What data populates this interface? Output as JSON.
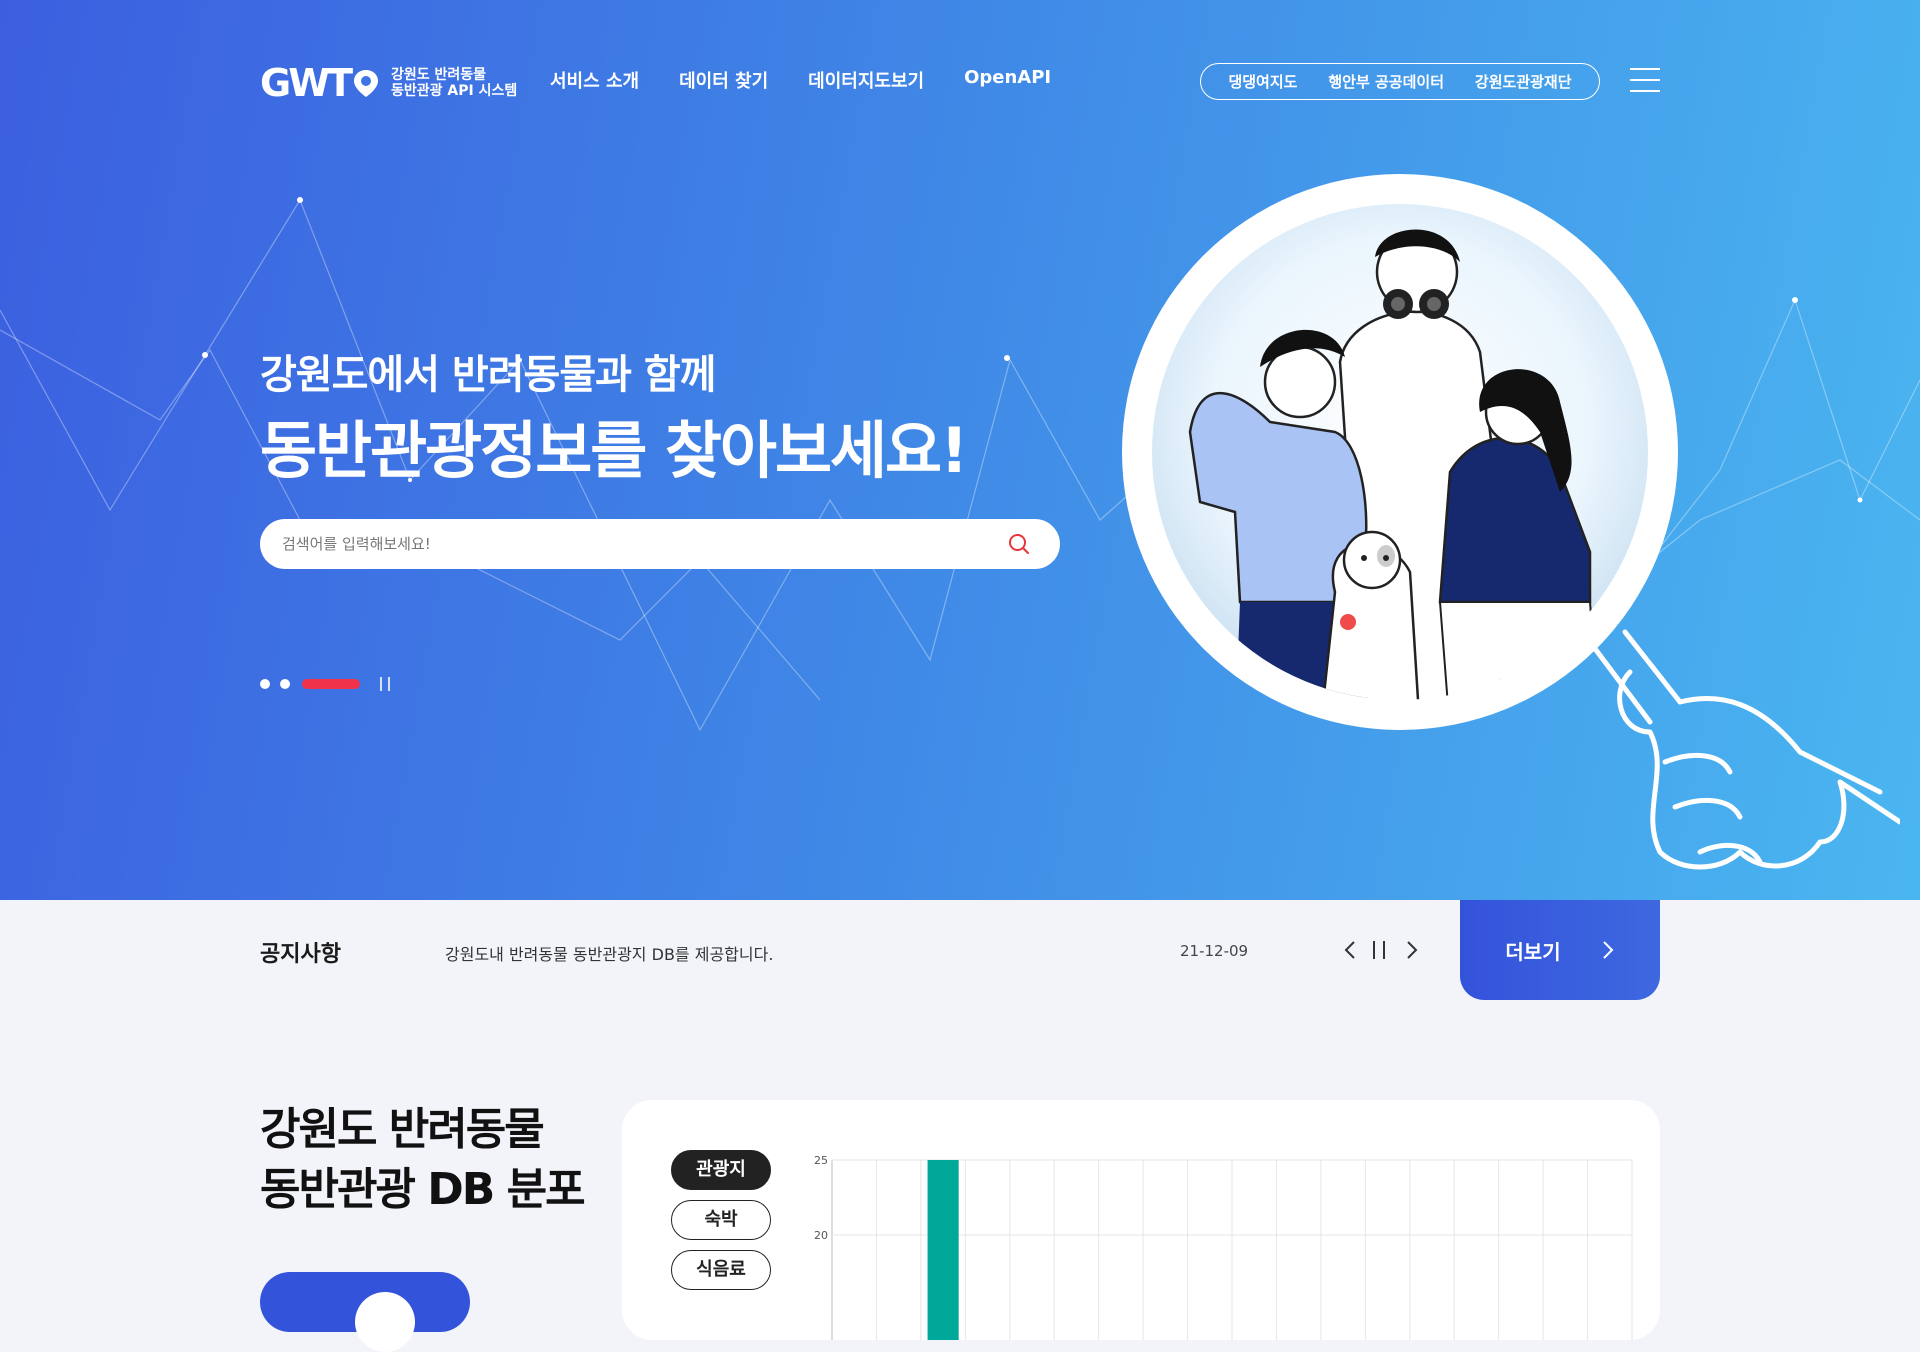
{
  "header": {
    "logo_mark": "GWT",
    "logo_line1": "강원도 반려동물",
    "logo_line2": "동반관광 API 시스템",
    "nav": [
      "서비스 소개",
      "데이터 찾기",
      "데이터지도보기",
      "OpenAPI"
    ],
    "quick_links": [
      "댕댕여지도",
      "행안부 공공데이터",
      "강원도관광재단"
    ],
    "menu_icon": "hamburger-icon"
  },
  "hero": {
    "subtitle": "강원도에서 반려동물과 함께",
    "title": "동반관광정보를 찾아보세요!",
    "search_placeholder": "검색어를 입력해보세요!",
    "search_icon": "search-icon",
    "slides_total": 3,
    "slide_active": 3,
    "colors": {
      "gradient_start": "#3c5fe0",
      "gradient_end": "#4ab6f0",
      "accent": "#f0334a"
    }
  },
  "notice": {
    "label": "공지사항",
    "text": "강원도내 반려동물 동반관광지 DB를 제공합니다.",
    "date": "21-12-09",
    "more_label": "더보기"
  },
  "db_section": {
    "title_line1": "강원도 반려동물",
    "title_line2": "동반관광 DB 분포",
    "categories": [
      "관광지",
      "숙박",
      "식음료"
    ],
    "active_category": "관광지"
  },
  "chart_data": {
    "type": "bar",
    "categories": [
      "",
      "",
      "",
      "",
      "",
      "",
      "",
      "",
      "",
      "",
      "",
      "",
      "",
      "",
      "",
      "",
      "",
      ""
    ],
    "values": [
      0,
      0,
      25,
      0,
      0,
      0,
      0,
      0,
      0,
      0,
      0,
      0,
      0,
      0,
      0,
      0,
      0,
      0
    ],
    "y_ticks": [
      "25",
      "20"
    ],
    "ylim_visible": [
      15,
      25
    ],
    "grid": true,
    "bar_color": "#00a89a"
  }
}
